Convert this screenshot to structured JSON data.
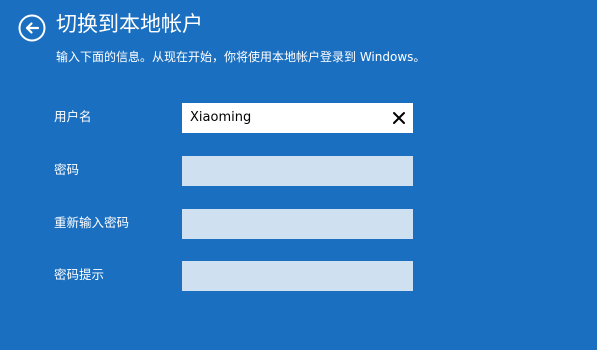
{
  "header": {
    "back_icon": "back-arrow-icon",
    "title": "切换到本地帐户",
    "subtitle": "输入下面的信息。从现在开始，你将使用本地帐户登录到 Windows。"
  },
  "form": {
    "username": {
      "label": "用户名",
      "value": "Xiaoming",
      "clear_icon": "close-icon"
    },
    "password": {
      "label": "密码",
      "value": ""
    },
    "confirm_password": {
      "label": "重新输入密码",
      "value": ""
    },
    "password_hint": {
      "label": "密码提示",
      "value": ""
    }
  },
  "colors": {
    "background": "#1a6fc1",
    "text": "#ffffff",
    "input_empty": "#cfe0f0",
    "input_active": "#ffffff"
  }
}
